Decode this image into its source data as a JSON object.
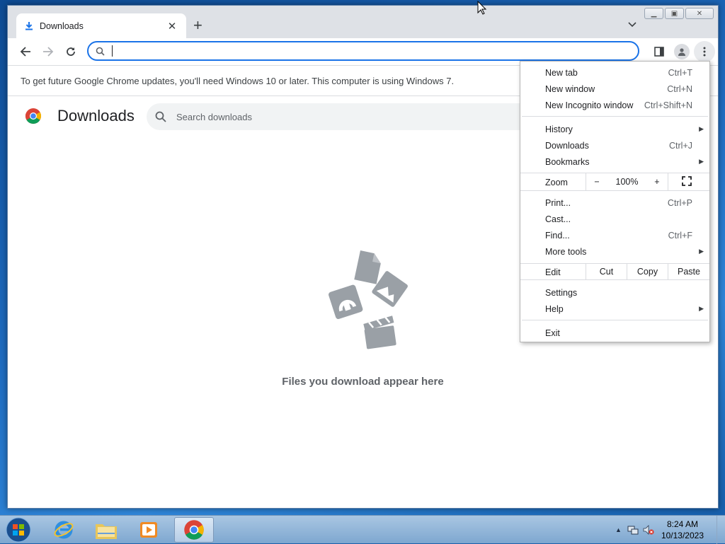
{
  "tab": {
    "title": "Downloads",
    "close": "✕",
    "new_tab": "+"
  },
  "omnibox": {
    "value": "",
    "placeholder": ""
  },
  "infobar": {
    "text": "To get future Google Chrome updates, you'll need Windows 10 or later. This computer is using Windows 7."
  },
  "downloads_page": {
    "title": "Downloads",
    "search_placeholder": "Search downloads",
    "empty_message": "Files you download appear here"
  },
  "menu": {
    "items_group1": [
      {
        "label": "New tab",
        "shortcut": "Ctrl+T"
      },
      {
        "label": "New window",
        "shortcut": "Ctrl+N"
      },
      {
        "label": "New Incognito window",
        "shortcut": "Ctrl+Shift+N"
      }
    ],
    "items_group2": [
      {
        "label": "History",
        "shortcut": "",
        "submenu": true
      },
      {
        "label": "Downloads",
        "shortcut": "Ctrl+J"
      },
      {
        "label": "Bookmarks",
        "shortcut": "",
        "submenu": true
      }
    ],
    "zoom": {
      "label": "Zoom",
      "minus": "−",
      "value": "100%",
      "plus": "+"
    },
    "items_group3": [
      {
        "label": "Print...",
        "shortcut": "Ctrl+P"
      },
      {
        "label": "Cast...",
        "shortcut": ""
      },
      {
        "label": "Find...",
        "shortcut": "Ctrl+F"
      },
      {
        "label": "More tools",
        "shortcut": "",
        "submenu": true
      }
    ],
    "edit": {
      "label": "Edit",
      "cut": "Cut",
      "copy": "Copy",
      "paste": "Paste"
    },
    "items_group4": [
      {
        "label": "Settings",
        "shortcut": ""
      },
      {
        "label": "Help",
        "shortcut": "",
        "submenu": true
      }
    ],
    "exit": {
      "label": "Exit"
    }
  },
  "taskbar": {
    "clock_time": "8:24 AM",
    "clock_date": "10/13/2023"
  },
  "colors": {
    "accent": "#1a73e8",
    "icon_gray": "#9aa0a6"
  }
}
